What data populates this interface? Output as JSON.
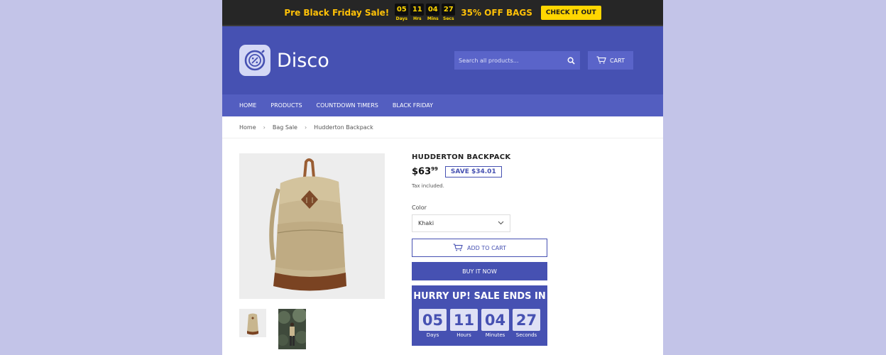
{
  "promo": {
    "text": "Pre Black Friday Sale!",
    "timer": [
      {
        "value": "05",
        "label": "Days"
      },
      {
        "value": "11",
        "label": "Hrs"
      },
      {
        "value": "04",
        "label": "Mins"
      },
      {
        "value": "27",
        "label": "Secs"
      }
    ],
    "offer": "35% OFF BAGS",
    "button": "CHECK IT OUT"
  },
  "header": {
    "logo_text": "Disco",
    "search_placeholder": "Search all products...",
    "cart_label": "CART"
  },
  "nav": [
    "HOME",
    "PRODUCTS",
    "COUNTDOWN TIMERS",
    "BLACK FRIDAY"
  ],
  "breadcrumb": [
    "Home",
    "Bag Sale",
    "Hudderton Backpack"
  ],
  "product": {
    "title": "HUDDERTON BACKPACK",
    "price_main": "$63",
    "price_cents": "99",
    "save": "SAVE $34.01",
    "tax": "Tax included.",
    "color_label": "Color",
    "color_value": "Khaki",
    "add_to_cart": "ADD TO CART",
    "buy_now": "BUY IT NOW"
  },
  "hurry": {
    "title": "HURRY UP! SALE ENDS IN",
    "timer": [
      {
        "value": "05",
        "label": "Days"
      },
      {
        "value": "11",
        "label": "Hours"
      },
      {
        "value": "04",
        "label": "Minutes"
      },
      {
        "value": "27",
        "label": "Seconds"
      }
    ]
  },
  "colors": {
    "brand": "#4651b2",
    "promo_bg": "#262626",
    "promo_accent": "#ffd600",
    "background": "#c3c4e8"
  }
}
